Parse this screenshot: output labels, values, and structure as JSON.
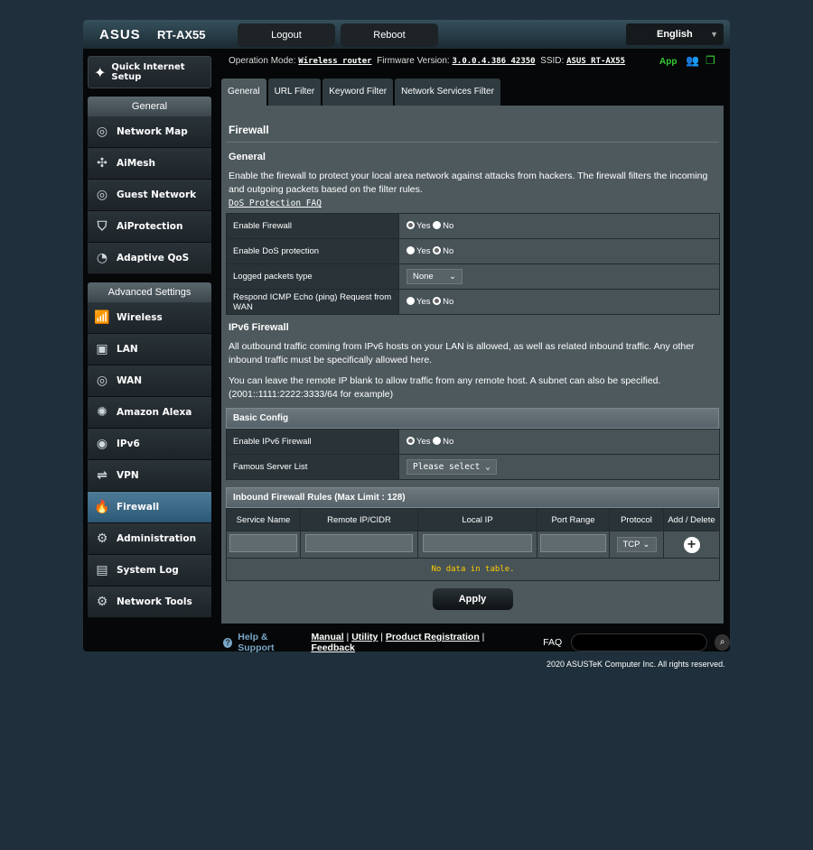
{
  "header": {
    "brand": "ASUS",
    "model": "RT-AX55",
    "logout": "Logout",
    "reboot": "Reboot",
    "language": "English"
  },
  "status": {
    "operation_mode_label": "Operation Mode:",
    "operation_mode": "Wireless router",
    "firmware_label": "Firmware Version:",
    "firmware": "3.0.0.4.386_42350",
    "ssid_label": "SSID:",
    "ssid": "ASUS_RT-AX55",
    "app": "App"
  },
  "sidebar": {
    "quick_setup": "Quick Internet Setup",
    "general_header": "General",
    "general": [
      "Network Map",
      "AiMesh",
      "Guest Network",
      "AiProtection",
      "Adaptive QoS"
    ],
    "advanced_header": "Advanced Settings",
    "advanced": [
      "Wireless",
      "LAN",
      "WAN",
      "Amazon Alexa",
      "IPv6",
      "VPN",
      "Firewall",
      "Administration",
      "System Log",
      "Network Tools"
    ],
    "active": "Firewall"
  },
  "tabs": [
    "General",
    "URL Filter",
    "Keyword Filter",
    "Network Services Filter"
  ],
  "main": {
    "title": "Firewall",
    "general_heading": "General",
    "description": "Enable the firewall to protect your local area network against attacks from hackers. The firewall filters the incoming and outgoing packets based on the filter rules.",
    "faq_link": "DoS Protection FAQ",
    "settings": [
      {
        "label": "Enable Firewall",
        "value": "Yes"
      },
      {
        "label": "Enable DoS protection",
        "value": "No"
      },
      {
        "label": "Logged packets type",
        "select": "None"
      },
      {
        "label": "Respond ICMP Echo (ping) Request from WAN",
        "value": "No"
      }
    ],
    "yes": "Yes",
    "no": "No",
    "ipv6_heading": "IPv6 Firewall",
    "ipv6_desc1": "All outbound traffic coming from IPv6 hosts on your LAN is allowed, as well as related inbound traffic. Any other inbound traffic must be specifically allowed here.",
    "ipv6_desc2": "You can leave the remote IP blank to allow traffic from any remote host. A subnet can also be specified. (2001::1111:2222:3333/64 for example)",
    "basic_config": "Basic Config",
    "enable_ipv6": "Enable IPv6 Firewall",
    "enable_ipv6_value": "Yes",
    "famous_server": "Famous Server List",
    "famous_select": "Please select",
    "rules_title": "Inbound Firewall Rules (Max Limit : 128)",
    "columns": [
      "Service Name",
      "Remote IP/CIDR",
      "Local IP",
      "Port Range",
      "Protocol",
      "Add / Delete"
    ],
    "protocol": "TCP",
    "empty": "No data in table.",
    "apply": "Apply"
  },
  "footer": {
    "help": "Help & Support",
    "links": [
      "Manual",
      "Utility",
      "Product Registration",
      "Feedback"
    ],
    "faq": "FAQ",
    "copyright": "2020 ASUSTeK Computer Inc. All rights reserved."
  },
  "colors": {
    "active_nav": "#4e7b98",
    "empty_text": "#ffcc00",
    "app": "#33cc33"
  }
}
